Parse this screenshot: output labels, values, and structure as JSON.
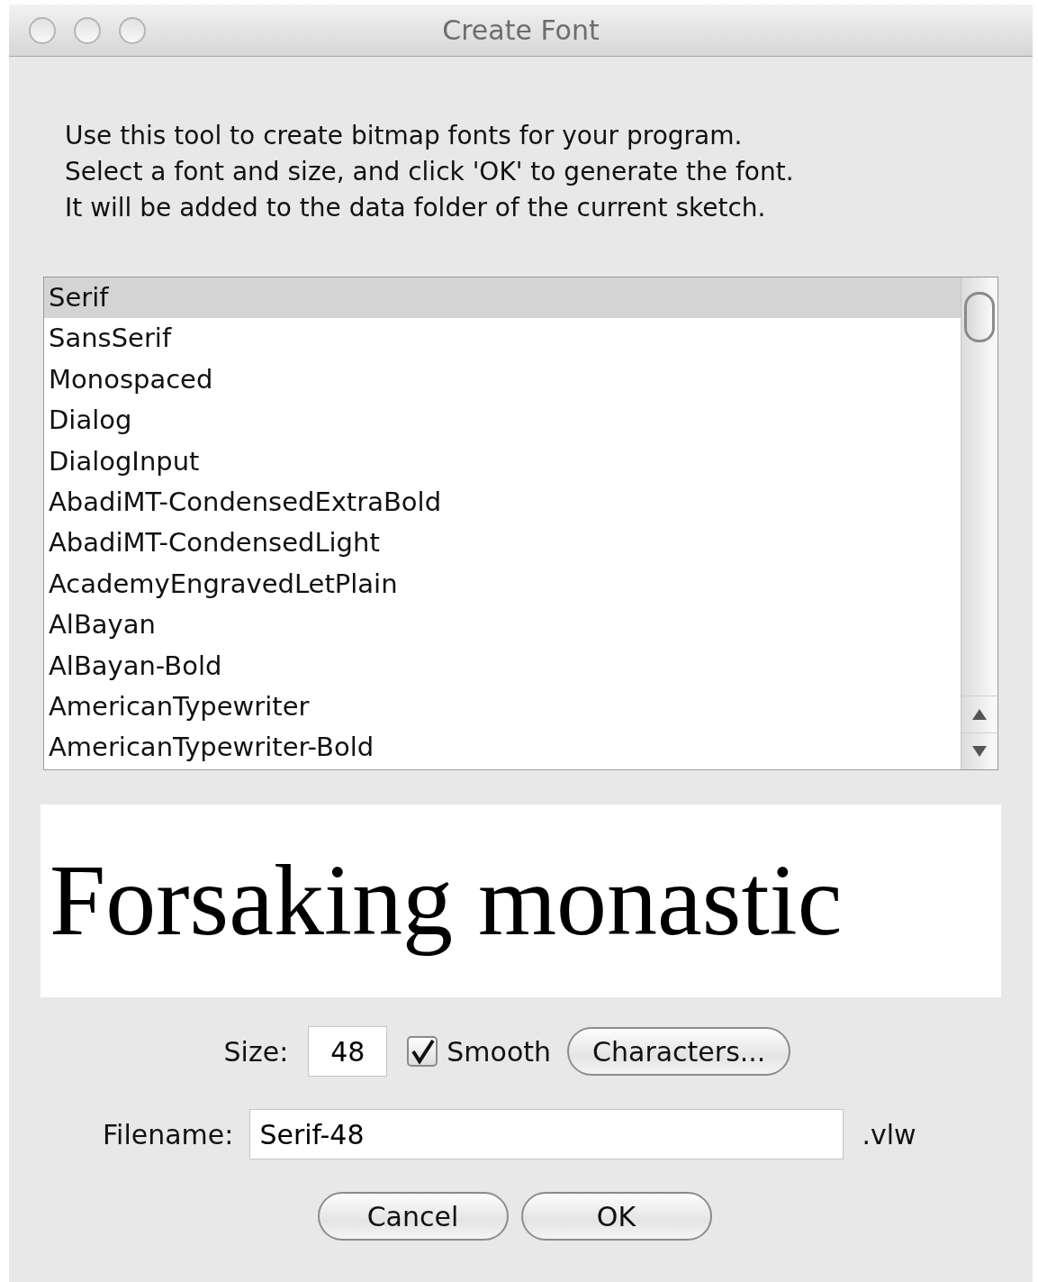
{
  "window": {
    "title": "Create Font"
  },
  "description": [
    "Use this tool to create bitmap fonts for your program.",
    "Select a font and size, and click 'OK' to generate the font.",
    "It will be added to the data folder of the current sketch."
  ],
  "font_list": {
    "items": [
      {
        "label": "Serif",
        "selected": true
      },
      {
        "label": "SansSerif",
        "selected": false
      },
      {
        "label": "Monospaced",
        "selected": false
      },
      {
        "label": "Dialog",
        "selected": false
      },
      {
        "label": "DialogInput",
        "selected": false
      },
      {
        "label": "AbadiMT-CondensedExtraBold",
        "selected": false
      },
      {
        "label": "AbadiMT-CondensedLight",
        "selected": false
      },
      {
        "label": "AcademyEngravedLetPlain",
        "selected": false
      },
      {
        "label": "AlBayan",
        "selected": false
      },
      {
        "label": "AlBayan-Bold",
        "selected": false
      },
      {
        "label": "AmericanTypewriter",
        "selected": false
      },
      {
        "label": "AmericanTypewriter-Bold",
        "selected": false
      }
    ]
  },
  "preview": {
    "text": "Forsaking monastic"
  },
  "size": {
    "label": "Size:",
    "value": "48"
  },
  "smooth": {
    "label": "Smooth",
    "checked": true
  },
  "characters_button": "Characters...",
  "filename": {
    "label": "Filename:",
    "value": "Serif-48",
    "extension": ".vlw"
  },
  "buttons": [
    "Cancel",
    "OK"
  ]
}
